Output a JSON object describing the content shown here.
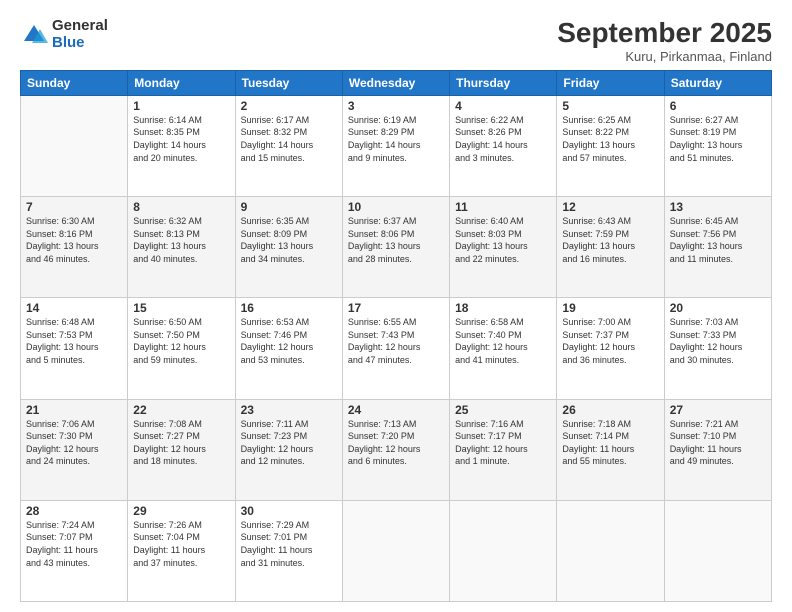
{
  "logo": {
    "general": "General",
    "blue": "Blue"
  },
  "header": {
    "month": "September 2025",
    "location": "Kuru, Pirkanmaa, Finland"
  },
  "weekdays": [
    "Sunday",
    "Monday",
    "Tuesday",
    "Wednesday",
    "Thursday",
    "Friday",
    "Saturday"
  ],
  "weeks": [
    [
      {
        "day": "",
        "info": ""
      },
      {
        "day": "1",
        "info": "Sunrise: 6:14 AM\nSunset: 8:35 PM\nDaylight: 14 hours\nand 20 minutes."
      },
      {
        "day": "2",
        "info": "Sunrise: 6:17 AM\nSunset: 8:32 PM\nDaylight: 14 hours\nand 15 minutes."
      },
      {
        "day": "3",
        "info": "Sunrise: 6:19 AM\nSunset: 8:29 PM\nDaylight: 14 hours\nand 9 minutes."
      },
      {
        "day": "4",
        "info": "Sunrise: 6:22 AM\nSunset: 8:26 PM\nDaylight: 14 hours\nand 3 minutes."
      },
      {
        "day": "5",
        "info": "Sunrise: 6:25 AM\nSunset: 8:22 PM\nDaylight: 13 hours\nand 57 minutes."
      },
      {
        "day": "6",
        "info": "Sunrise: 6:27 AM\nSunset: 8:19 PM\nDaylight: 13 hours\nand 51 minutes."
      }
    ],
    [
      {
        "day": "7",
        "info": "Sunrise: 6:30 AM\nSunset: 8:16 PM\nDaylight: 13 hours\nand 46 minutes."
      },
      {
        "day": "8",
        "info": "Sunrise: 6:32 AM\nSunset: 8:13 PM\nDaylight: 13 hours\nand 40 minutes."
      },
      {
        "day": "9",
        "info": "Sunrise: 6:35 AM\nSunset: 8:09 PM\nDaylight: 13 hours\nand 34 minutes."
      },
      {
        "day": "10",
        "info": "Sunrise: 6:37 AM\nSunset: 8:06 PM\nDaylight: 13 hours\nand 28 minutes."
      },
      {
        "day": "11",
        "info": "Sunrise: 6:40 AM\nSunset: 8:03 PM\nDaylight: 13 hours\nand 22 minutes."
      },
      {
        "day": "12",
        "info": "Sunrise: 6:43 AM\nSunset: 7:59 PM\nDaylight: 13 hours\nand 16 minutes."
      },
      {
        "day": "13",
        "info": "Sunrise: 6:45 AM\nSunset: 7:56 PM\nDaylight: 13 hours\nand 11 minutes."
      }
    ],
    [
      {
        "day": "14",
        "info": "Sunrise: 6:48 AM\nSunset: 7:53 PM\nDaylight: 13 hours\nand 5 minutes."
      },
      {
        "day": "15",
        "info": "Sunrise: 6:50 AM\nSunset: 7:50 PM\nDaylight: 12 hours\nand 59 minutes."
      },
      {
        "day": "16",
        "info": "Sunrise: 6:53 AM\nSunset: 7:46 PM\nDaylight: 12 hours\nand 53 minutes."
      },
      {
        "day": "17",
        "info": "Sunrise: 6:55 AM\nSunset: 7:43 PM\nDaylight: 12 hours\nand 47 minutes."
      },
      {
        "day": "18",
        "info": "Sunrise: 6:58 AM\nSunset: 7:40 PM\nDaylight: 12 hours\nand 41 minutes."
      },
      {
        "day": "19",
        "info": "Sunrise: 7:00 AM\nSunset: 7:37 PM\nDaylight: 12 hours\nand 36 minutes."
      },
      {
        "day": "20",
        "info": "Sunrise: 7:03 AM\nSunset: 7:33 PM\nDaylight: 12 hours\nand 30 minutes."
      }
    ],
    [
      {
        "day": "21",
        "info": "Sunrise: 7:06 AM\nSunset: 7:30 PM\nDaylight: 12 hours\nand 24 minutes."
      },
      {
        "day": "22",
        "info": "Sunrise: 7:08 AM\nSunset: 7:27 PM\nDaylight: 12 hours\nand 18 minutes."
      },
      {
        "day": "23",
        "info": "Sunrise: 7:11 AM\nSunset: 7:23 PM\nDaylight: 12 hours\nand 12 minutes."
      },
      {
        "day": "24",
        "info": "Sunrise: 7:13 AM\nSunset: 7:20 PM\nDaylight: 12 hours\nand 6 minutes."
      },
      {
        "day": "25",
        "info": "Sunrise: 7:16 AM\nSunset: 7:17 PM\nDaylight: 12 hours\nand 1 minute."
      },
      {
        "day": "26",
        "info": "Sunrise: 7:18 AM\nSunset: 7:14 PM\nDaylight: 11 hours\nand 55 minutes."
      },
      {
        "day": "27",
        "info": "Sunrise: 7:21 AM\nSunset: 7:10 PM\nDaylight: 11 hours\nand 49 minutes."
      }
    ],
    [
      {
        "day": "28",
        "info": "Sunrise: 7:24 AM\nSunset: 7:07 PM\nDaylight: 11 hours\nand 43 minutes."
      },
      {
        "day": "29",
        "info": "Sunrise: 7:26 AM\nSunset: 7:04 PM\nDaylight: 11 hours\nand 37 minutes."
      },
      {
        "day": "30",
        "info": "Sunrise: 7:29 AM\nSunset: 7:01 PM\nDaylight: 11 hours\nand 31 minutes."
      },
      {
        "day": "",
        "info": ""
      },
      {
        "day": "",
        "info": ""
      },
      {
        "day": "",
        "info": ""
      },
      {
        "day": "",
        "info": ""
      }
    ]
  ]
}
